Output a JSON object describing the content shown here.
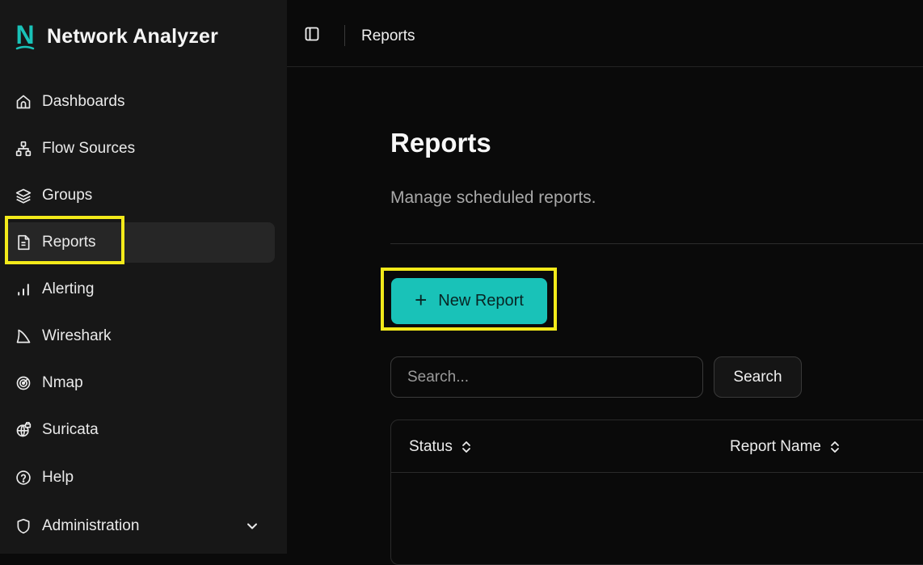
{
  "app": {
    "title": "Network Analyzer",
    "logo_letter": "N"
  },
  "sidebar": {
    "items": [
      {
        "label": "Dashboards",
        "icon": "home-icon"
      },
      {
        "label": "Flow Sources",
        "icon": "network-icon"
      },
      {
        "label": "Groups",
        "icon": "layers-icon"
      },
      {
        "label": "Reports",
        "icon": "file-text-icon",
        "active": true
      },
      {
        "label": "Alerting",
        "icon": "bar-chart-icon"
      },
      {
        "label": "Wireshark",
        "icon": "shark-fin-icon"
      },
      {
        "label": "Nmap",
        "icon": "radar-icon"
      },
      {
        "label": "Suricata",
        "icon": "globe-lock-icon"
      },
      {
        "label": "Help",
        "icon": "help-circle-icon"
      },
      {
        "label": "Administration",
        "icon": "shield-icon",
        "expandable": true
      }
    ]
  },
  "header": {
    "breadcrumb": "Reports"
  },
  "page": {
    "title": "Reports",
    "subtitle": "Manage scheduled reports.",
    "new_button_label": "New Report"
  },
  "search": {
    "placeholder": "Search...",
    "value": "",
    "button_label": "Search"
  },
  "table": {
    "columns": [
      {
        "label": "Status",
        "sortable": true
      },
      {
        "label": "Report Name",
        "sortable": true
      }
    ],
    "rows": []
  },
  "colors": {
    "accent": "#19c2b8",
    "highlight": "#f3ea1a",
    "sidebar_bg": "#171717",
    "main_bg": "#0a0a0a"
  }
}
